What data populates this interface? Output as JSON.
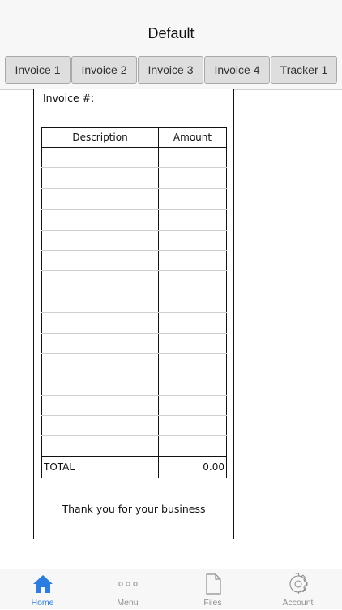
{
  "nav": {
    "title": "Default"
  },
  "sheet_tabs": [
    {
      "label": "Invoice 1"
    },
    {
      "label": "Invoice 2"
    },
    {
      "label": "Invoice 3"
    },
    {
      "label": "Invoice 4"
    },
    {
      "label": "Tracker 1"
    }
  ],
  "invoice": {
    "number_label": "Invoice #:",
    "columns": {
      "description": "Description",
      "amount": "Amount"
    },
    "empty_row_count_shown": 15,
    "total_label": "TOTAL",
    "total_value": "0.00",
    "footer": "Thank you for your business"
  },
  "tab_bar": {
    "items": [
      {
        "label": "Home",
        "icon": "home-icon",
        "active": true
      },
      {
        "label": "Menu",
        "icon": "ellipsis-icon",
        "active": false
      },
      {
        "label": "Files",
        "icon": "file-icon",
        "active": false
      },
      {
        "label": "Account",
        "icon": "gear-icon",
        "active": false
      }
    ],
    "active_color": "#2b7de1",
    "inactive_color": "#8e8e8e"
  }
}
